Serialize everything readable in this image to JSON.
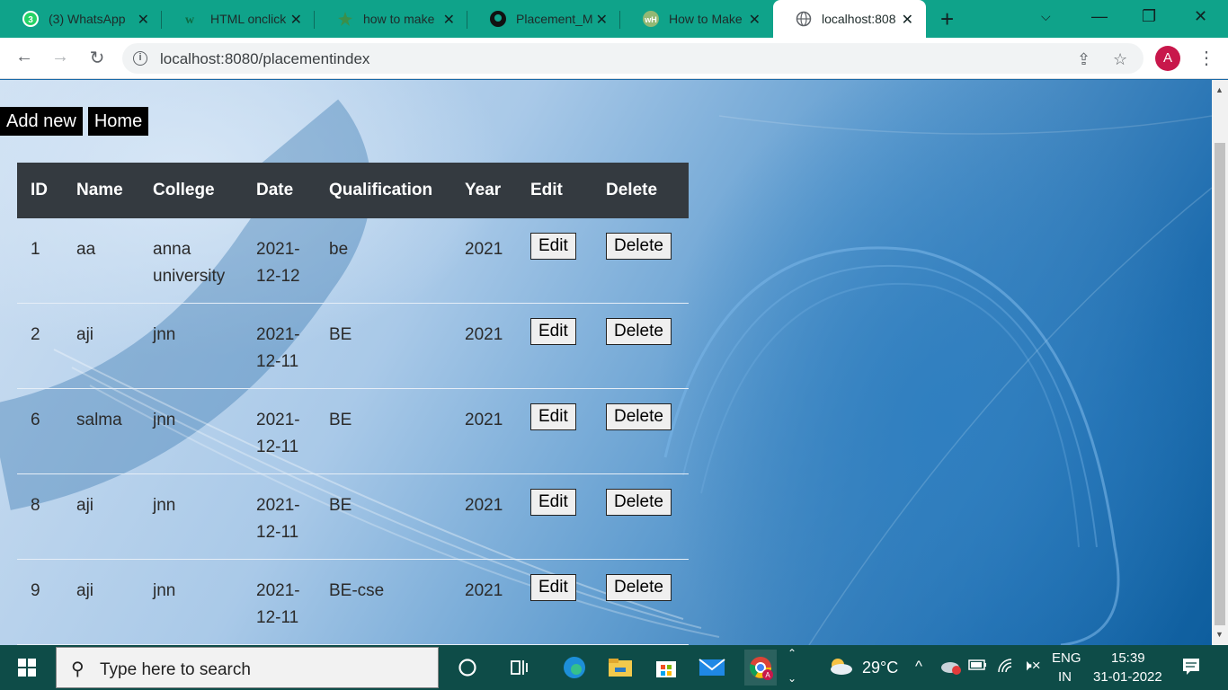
{
  "browser": {
    "tabs": [
      {
        "title": "(3) WhatsApp",
        "icon": "whatsapp-icon"
      },
      {
        "title": "HTML onclick",
        "icon": "w3-icon"
      },
      {
        "title": "how to make",
        "icon": "star-icon"
      },
      {
        "title": "Placement_M",
        "icon": "github-icon"
      },
      {
        "title": "How to Make",
        "icon": "wikihow-icon"
      },
      {
        "title": "localhost:808",
        "icon": "globe-icon"
      }
    ],
    "url": "localhost:8080/placementindex",
    "profile_initial": "A"
  },
  "page": {
    "buttons": {
      "add_new": "Add new",
      "home": "Home"
    },
    "table": {
      "headers": [
        "ID",
        "Name",
        "College",
        "Date",
        "Qualification",
        "Year",
        "Edit",
        "Delete"
      ],
      "rows": [
        {
          "id": "1",
          "name": "aa",
          "college": "anna university",
          "date": "2021-12-12",
          "qualification": "be",
          "year": "2021",
          "edit": "Edit",
          "delete": "Delete"
        },
        {
          "id": "2",
          "name": "aji",
          "college": "jnn",
          "date": "2021-12-11",
          "qualification": "BE",
          "year": "2021",
          "edit": "Edit",
          "delete": "Delete"
        },
        {
          "id": "6",
          "name": "salma",
          "college": "jnn",
          "date": "2021-12-11",
          "qualification": "BE",
          "year": "2021",
          "edit": "Edit",
          "delete": "Delete"
        },
        {
          "id": "8",
          "name": "aji",
          "college": "jnn",
          "date": "2021-12-11",
          "qualification": "BE",
          "year": "2021",
          "edit": "Edit",
          "delete": "Delete"
        },
        {
          "id": "9",
          "name": "aji",
          "college": "jnn",
          "date": "2021-12-11",
          "qualification": "BE-cse",
          "year": "2021",
          "edit": "Edit",
          "delete": "Delete"
        }
      ]
    }
  },
  "taskbar": {
    "search_placeholder": "Type here to search",
    "weather": "29°C",
    "lang_top": "ENG",
    "lang_bottom": "IN",
    "time": "15:39",
    "date": "31-01-2022"
  },
  "colors": {
    "tab_strip": "#0fa38a",
    "taskbar": "#0e4c48",
    "table_header": "#343a40"
  }
}
